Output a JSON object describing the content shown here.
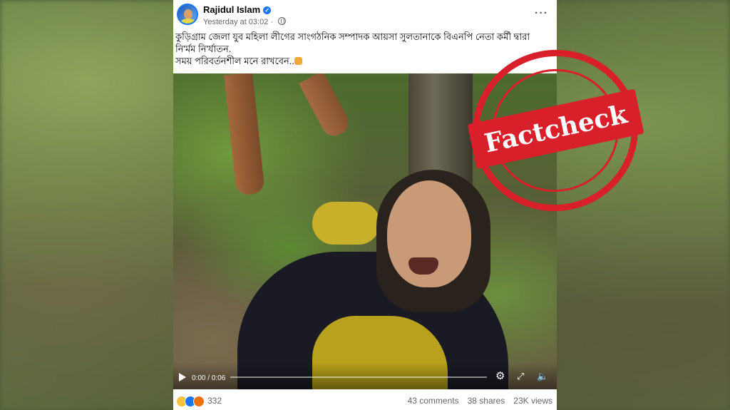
{
  "post": {
    "author": "Rajidul Islam",
    "timestamp": "Yesterday at 03:02",
    "more_icon": "more-options-icon",
    "text_lines": [
      "কুড়িগ্রাম জেলা যুব মহিলা লীগের সাংগঠনিক সম্পাদক আয়সা সুলতানাকে বিএনপি নেতা কর্মী দ্বারা",
      "নি'র্মম নি'র্যাতন.",
      "সময় পরিবর্তনশীল মনে রাখবেন.."
    ]
  },
  "video": {
    "time": "0:00 / 0:06",
    "progress": 0
  },
  "footer": {
    "reaction_count": "332",
    "comments": "43 comments",
    "shares": "38 shares",
    "views": "23K views"
  },
  "stamp": {
    "label": "Factcheck",
    "color": "#d81f2a"
  }
}
